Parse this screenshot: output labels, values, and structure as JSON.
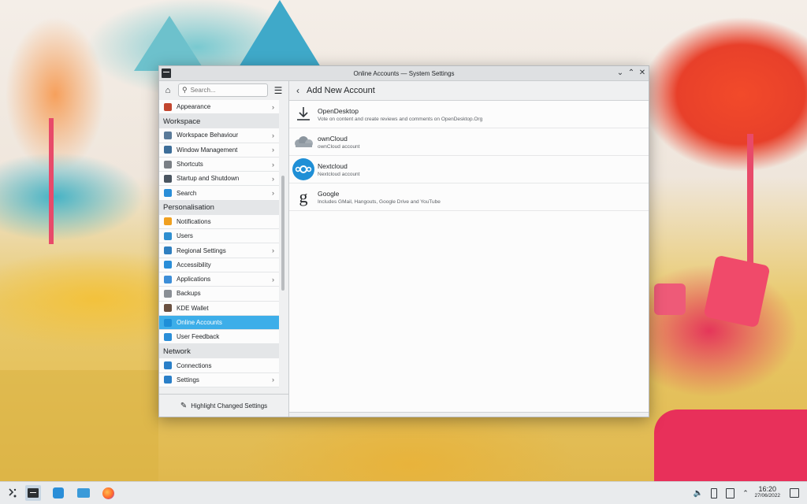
{
  "window": {
    "title": "Online Accounts — System Settings"
  },
  "sidebar": {
    "search_placeholder": "Search...",
    "entries": [
      {
        "kind": "item",
        "label": "Appearance",
        "chevron": true,
        "icon": "appearance-icon",
        "color": "#c2462f"
      },
      {
        "kind": "category",
        "label": "Workspace"
      },
      {
        "kind": "item",
        "label": "Workspace Behaviour",
        "chevron": true,
        "icon": "workspace-icon",
        "color": "#5a7a99"
      },
      {
        "kind": "item",
        "label": "Window Management",
        "chevron": true,
        "icon": "window-icon",
        "color": "#3d6e99"
      },
      {
        "kind": "item",
        "label": "Shortcuts",
        "chevron": true,
        "icon": "keyboard-icon",
        "color": "#7a7f85"
      },
      {
        "kind": "item",
        "label": "Startup and Shutdown",
        "chevron": true,
        "icon": "startup-icon",
        "color": "#4a5560"
      },
      {
        "kind": "item",
        "label": "Search",
        "chevron": true,
        "icon": "search-icon",
        "color": "#2a8ed8"
      },
      {
        "kind": "category",
        "label": "Personalisation"
      },
      {
        "kind": "item",
        "label": "Notifications",
        "chevron": false,
        "icon": "bell-icon",
        "color": "#f0a020"
      },
      {
        "kind": "item",
        "label": "Users",
        "chevron": false,
        "icon": "users-icon",
        "color": "#2f8fd0"
      },
      {
        "kind": "item",
        "label": "Regional Settings",
        "chevron": true,
        "icon": "regional-icon",
        "color": "#2f7fc0"
      },
      {
        "kind": "item",
        "label": "Accessibility",
        "chevron": false,
        "icon": "accessibility-icon",
        "color": "#2a8ed8"
      },
      {
        "kind": "item",
        "label": "Applications",
        "chevron": true,
        "icon": "applications-icon",
        "color": "#3d8ed8"
      },
      {
        "kind": "item",
        "label": "Backups",
        "chevron": false,
        "icon": "backup-icon",
        "color": "#8a8f95"
      },
      {
        "kind": "item",
        "label": "KDE Wallet",
        "chevron": false,
        "icon": "wallet-icon",
        "color": "#6a5040"
      },
      {
        "kind": "item",
        "label": "Online Accounts",
        "chevron": false,
        "icon": "online-accounts-icon",
        "color": "#1d8fd8",
        "active": true
      },
      {
        "kind": "item",
        "label": "User Feedback",
        "chevron": false,
        "icon": "feedback-icon",
        "color": "#2a8ed8"
      },
      {
        "kind": "category",
        "label": "Network"
      },
      {
        "kind": "item",
        "label": "Connections",
        "chevron": false,
        "icon": "globe-icon",
        "color": "#2a7fc8"
      },
      {
        "kind": "item",
        "label": "Settings",
        "chevron": true,
        "icon": "network-settings-icon",
        "color": "#2a7fc8"
      }
    ],
    "footer_label": "Highlight Changed Settings"
  },
  "main": {
    "title": "Add New Account",
    "accounts": [
      {
        "name": "OpenDesktop",
        "desc": "Vote on content and create reviews and comments on OpenDesktop.Org",
        "icon": "download-icon"
      },
      {
        "name": "ownCloud",
        "desc": "ownCloud account",
        "icon": "cloud-icon"
      },
      {
        "name": "Nextcloud",
        "desc": "Nextcloud account",
        "icon": "nextcloud-icon"
      },
      {
        "name": "Google",
        "desc": "Includes GMail, Hangouts, Google Drive and YouTube",
        "icon": "google-icon"
      }
    ]
  },
  "taskbar": {
    "time": "16:20",
    "date": "27/06/2022"
  }
}
